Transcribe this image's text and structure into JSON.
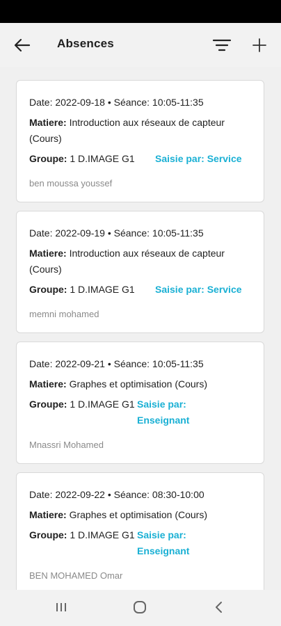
{
  "header": {
    "title": "Absences",
    "back_icon": "arrow-left-icon",
    "filter_icon": "filter-icon",
    "add_icon": "plus-icon"
  },
  "accent_color": "#1ab0d4",
  "absences": [
    {
      "date_line": "Date: 2022-09-18 • Séance: 10:05-11:35",
      "matiere_label": "Matiere:",
      "matiere_value": " Introduction aux réseaux de capteur (Cours)",
      "groupe_label": "Groupe:",
      "groupe_value": " 1 D.IMAGE G1",
      "saisie": "Saisie par: Service",
      "person": "ben moussa youssef"
    },
    {
      "date_line": "Date: 2022-09-19 • Séance: 10:05-11:35",
      "matiere_label": "Matiere:",
      "matiere_value": " Introduction aux réseaux de capteur (Cours)",
      "groupe_label": "Groupe:",
      "groupe_value": " 1 D.IMAGE G1",
      "saisie": "Saisie par: Service",
      "person": "memni mohamed"
    },
    {
      "date_line": "Date: 2022-09-21 • Séance: 10:05-11:35",
      "matiere_label": "Matiere:",
      "matiere_value": " Graphes et optimisation (Cours)",
      "groupe_label": "Groupe:",
      "groupe_value": " 1 D.IMAGE G1",
      "saisie": "Saisie par: Enseignant",
      "person": "Mnassri Mohamed"
    },
    {
      "date_line": "Date: 2022-09-22 • Séance: 08:30-10:00",
      "matiere_label": "Matiere:",
      "matiere_value": " Graphes et optimisation (Cours)",
      "groupe_label": "Groupe:",
      "groupe_value": " 1 D.IMAGE G1",
      "saisie": "Saisie par: Enseignant",
      "person": "BEN MOHAMED Omar"
    }
  ],
  "nav": {
    "recents_icon": "recent-apps-icon",
    "home_icon": "home-icon",
    "back_icon": "nav-back-icon"
  }
}
